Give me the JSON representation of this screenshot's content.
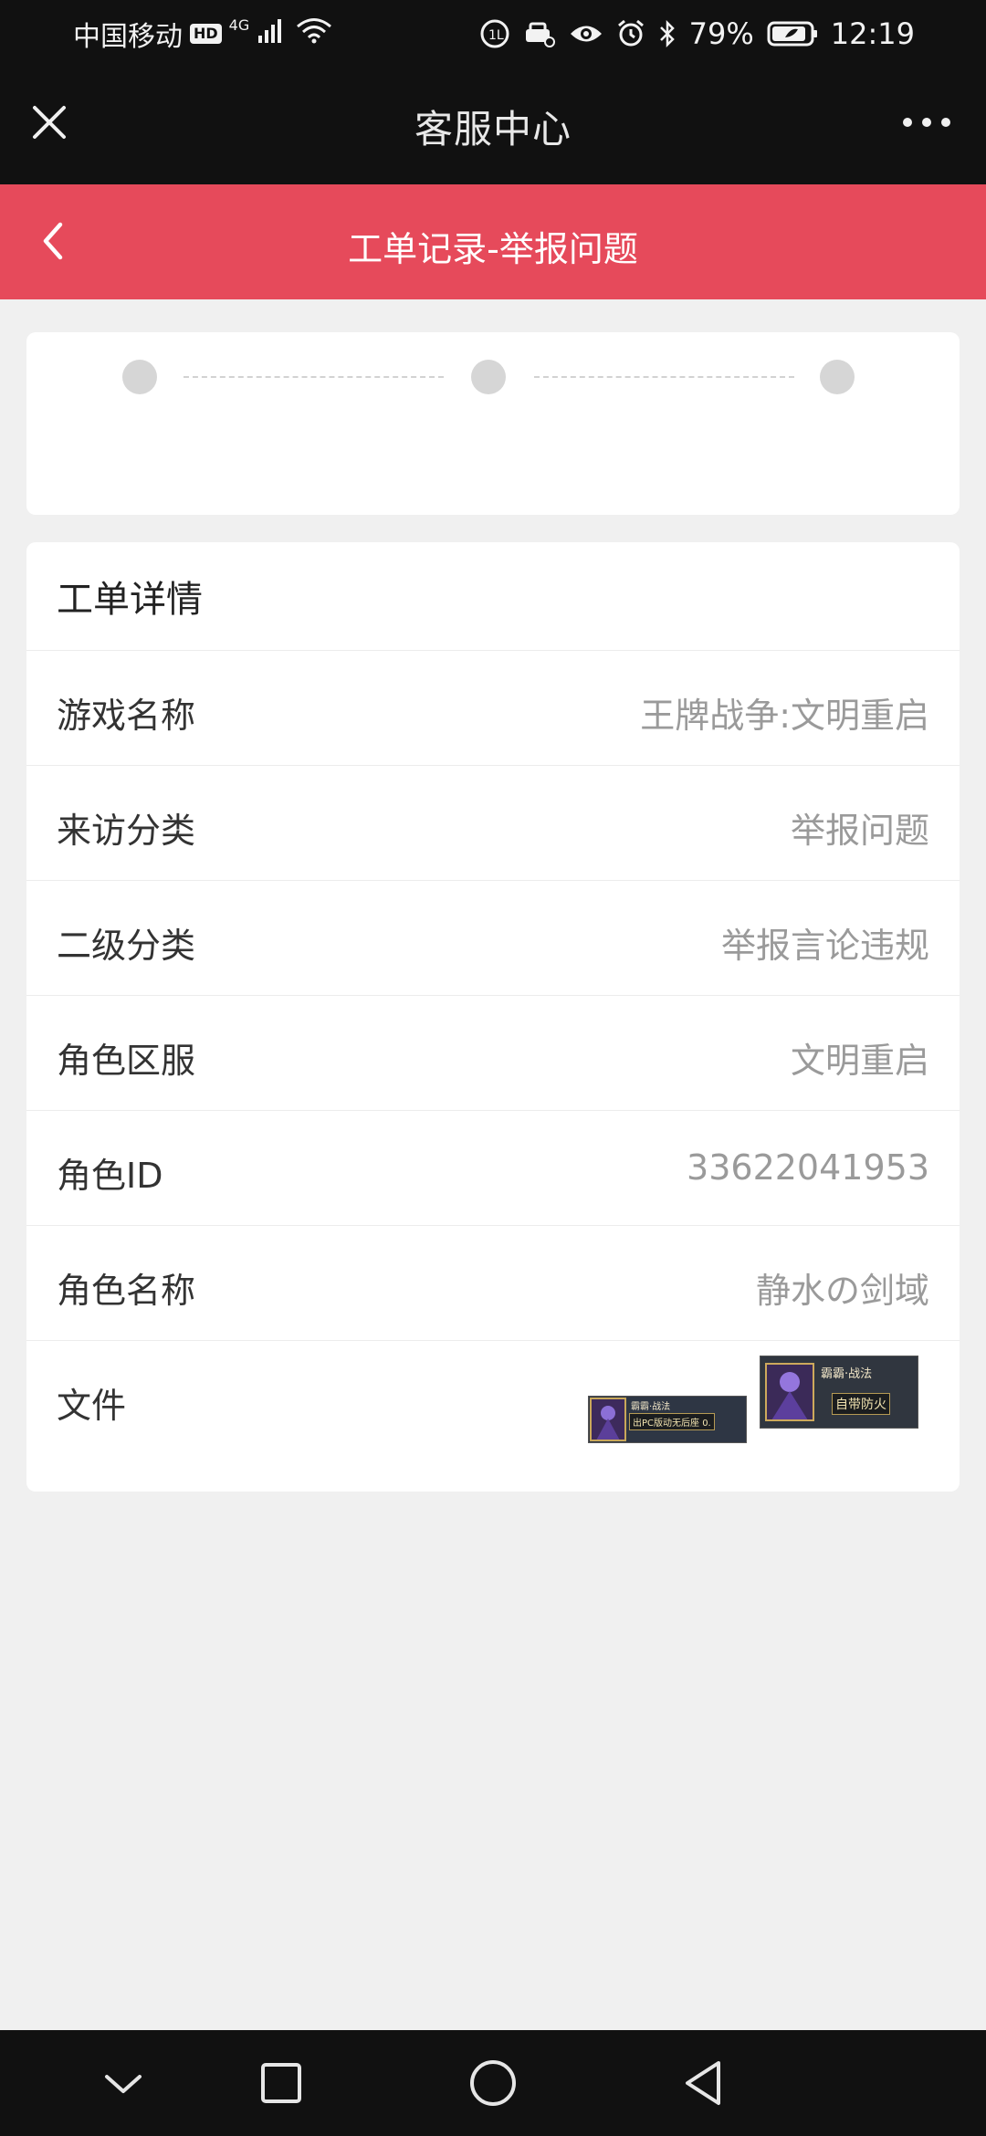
{
  "status_bar": {
    "carrier": "中国移动",
    "hd_badge": "HD",
    "network": "4G",
    "battery": "79%",
    "time": "12:19"
  },
  "title_bar": {
    "title": "客服中心"
  },
  "page_header": {
    "title": "工单记录-举报问题"
  },
  "progress": {
    "steps": 3
  },
  "details": {
    "header": "工单详情",
    "rows": [
      {
        "label": "游戏名称",
        "value": "王牌战争:文明重启"
      },
      {
        "label": "来访分类",
        "value": "举报问题"
      },
      {
        "label": "二级分类",
        "value": "举报言论违规"
      },
      {
        "label": "角色区服",
        "value": "文明重启"
      },
      {
        "label": "角色ID",
        "value": "33622041953"
      },
      {
        "label": "角色名称",
        "value": "静水の剑域"
      }
    ],
    "files_label": "文件",
    "files": [
      {
        "caption_top": "霸霸·战法",
        "caption_badge": "出PC版动无后座 0."
      },
      {
        "caption_top": "霸霸·战法",
        "caption_badge": "自带防火"
      }
    ]
  },
  "colors": {
    "accent": "#e64a5b",
    "bar": "#111111",
    "background": "#f0f0f0"
  }
}
